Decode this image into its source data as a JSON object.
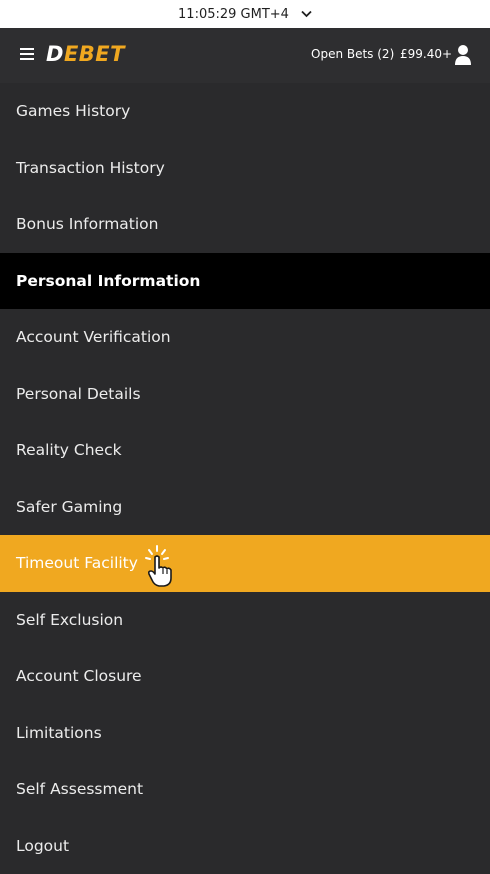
{
  "status_bar": {
    "time": "11:05:29 GMT+4"
  },
  "header": {
    "logo_part1": "D",
    "logo_part2": "E",
    "logo_part3": "BET",
    "open_bets": "Open Bets (2)",
    "balance": "£99.40+"
  },
  "colors": {
    "accent": "#f0a820",
    "background": "#2a2a2c",
    "section": "#000000"
  },
  "menu": {
    "items": [
      {
        "label": "Games History"
      },
      {
        "label": "Transaction History"
      },
      {
        "label": "Bonus Information"
      },
      {
        "label": "Personal Information"
      },
      {
        "label": "Account Verification"
      },
      {
        "label": "Personal Details"
      },
      {
        "label": "Reality Check"
      },
      {
        "label": "Safer Gaming"
      },
      {
        "label": "Timeout Facility"
      },
      {
        "label": "Self Exclusion"
      },
      {
        "label": "Account Closure"
      },
      {
        "label": "Limitations"
      },
      {
        "label": "Self Assessment"
      },
      {
        "label": "Logout"
      }
    ]
  }
}
